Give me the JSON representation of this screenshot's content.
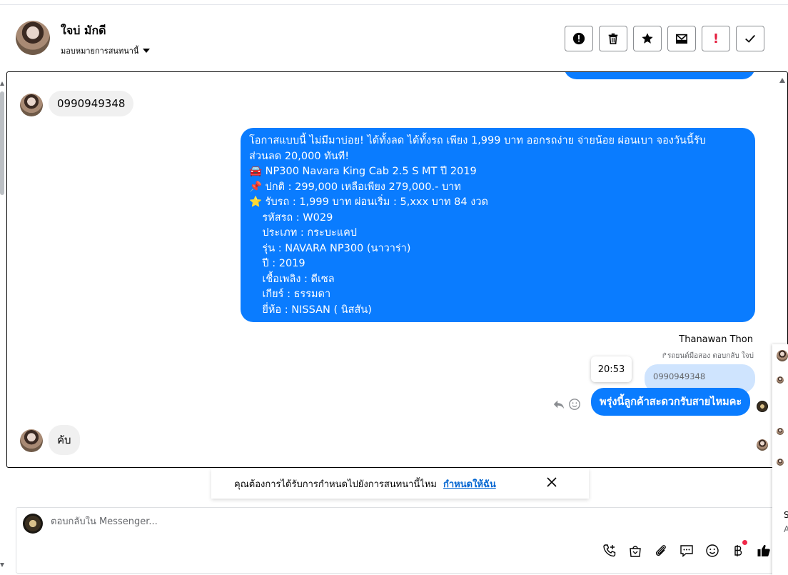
{
  "header": {
    "contact_name": "ใจบ่ มักดี",
    "assign_label": "มอบหมายการสนทนานี้",
    "actions": [
      {
        "name": "spam-icon"
      },
      {
        "name": "trash-icon"
      },
      {
        "name": "star-icon"
      },
      {
        "name": "mark-unread-icon"
      },
      {
        "name": "important-icon",
        "label": "!"
      },
      {
        "name": "done-icon"
      }
    ]
  },
  "messages": {
    "incoming_phone": "0990949348",
    "outgoing_promo": [
      "โอกาสแบบนี้ ไม่มีมาบ่อย! ได้ทั้งลด ได้ทั้งรถ เพียง 1,999 บาท ออกรถง่าย จ่ายน้อย ผ่อนเบา จองวันนี้รับ",
      "ส่วนลด 20,000 ทันที!",
      "🚘 NP300 Navara King Cab 2.5 S MT ปี 2019",
      "📌 ปกติ : 299,000 เหลือเพียง 279,000.- บาท",
      "⭐ รับรถ : 1,999 บาท ผ่อนเริ่ม : 5,xxx บาท 84 งวด",
      "    รหัสรถ : W029",
      "    ประเภท : กระบะแคป",
      "    รุ่น : NAVARA NP300 (นาวาร่า)",
      "    ปี : 2019",
      "    เชื้อเพลิง : ดีเซล",
      "    เกียร์ : ธรรมดา",
      "    ยี่ห้อ : NISSAN ( นิสสัน)"
    ],
    "sender_name": "Thanawan Thon",
    "replied_to": "↱รถยนต์มือสอง ตอบกลับ ใจบ่",
    "quoted_text": "0990949348",
    "time_tooltip": "20:53",
    "reply_text": "พรุ่งนี้ลูกค้าสะดวกรับสายไหมคะ",
    "incoming_last": "คับ"
  },
  "reminder": {
    "text": "คุณต้องการได้รับการกำหนดไปยังการสนทนานี้ไหม",
    "link": "กำหนดให้ฉัน"
  },
  "composer": {
    "placeholder": "ตอบกลับใน Messenger...",
    "tools": [
      "call-icon",
      "shopping-bag-icon",
      "attach-icon",
      "saved-reply-icon",
      "emoji-icon",
      "baht-payment-icon",
      "thumbs-up-icon"
    ]
  },
  "right_panel": {
    "letter_top": "S",
    "letter_bottom": "A"
  },
  "colors": {
    "messenger_blue": "#0a7cff",
    "incoming_gray": "#f0f0f0",
    "quoted_blue": "#cfe4fe",
    "link_blue": "#0064d1"
  }
}
